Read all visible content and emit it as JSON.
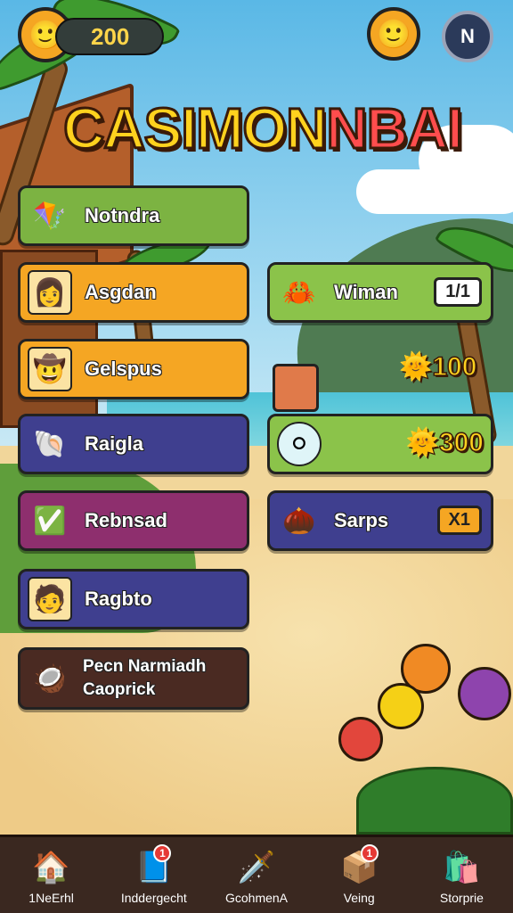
{
  "header": {
    "coin_amount": "200",
    "profile_button": "N",
    "title_part1": "CASIMON",
    "title_part2": "NBAI"
  },
  "menu_left": [
    {
      "label": "Notndra",
      "color": "#7cb342"
    },
    {
      "label": "Asgdan",
      "color": "#f5a623"
    },
    {
      "label": "Gelspus",
      "color": "#f5a623"
    },
    {
      "label": "Raigla",
      "color": "#3f3f8f"
    },
    {
      "label": "Rebnsad",
      "color": "#8e2f6e"
    },
    {
      "label": "Ragbto",
      "color": "#3f3f8f"
    },
    {
      "label_line1": "Pecn Narmiadh",
      "label_line2": "Caoprick",
      "color": "#4a2a22"
    }
  ],
  "menu_right": [
    {
      "label": "Wiman",
      "badge": "1/1",
      "color": "#8bc34a"
    },
    {
      "reward": "100"
    },
    {
      "badge": "300",
      "color": "#8bc34a"
    },
    {
      "label": "Sarps",
      "badge": "X1",
      "color": "#3f3f8f"
    }
  ],
  "bottom_nav": [
    {
      "label": "1NeErhl",
      "icon": "home-icon"
    },
    {
      "label": "Inddergecht",
      "icon": "book-icon",
      "notification": "1"
    },
    {
      "label": "GcohmenA",
      "icon": "sword-icon"
    },
    {
      "label": "Veing",
      "icon": "box-icon",
      "notification": "1"
    },
    {
      "label": "Storprie",
      "icon": "shop-icon"
    }
  ]
}
